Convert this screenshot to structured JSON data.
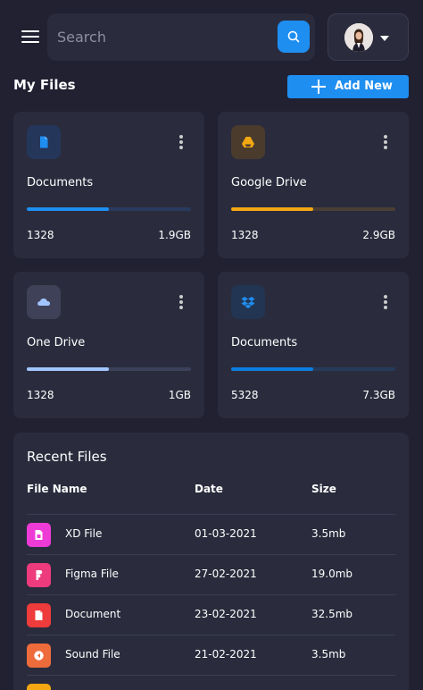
{
  "header": {
    "menu_icon": "hamburger-menu-icon",
    "search": {
      "placeholder": "Search",
      "value": "",
      "button_icon": "search-icon"
    },
    "profile": {
      "caret_icon": "caret-down-icon"
    }
  },
  "main": {
    "title": "My Files",
    "add_button": {
      "label": "Add New",
      "icon": "plus-icon"
    }
  },
  "storage_cards": [
    {
      "name": "Documents",
      "count": "1328",
      "size": "1.9GB",
      "usage": 0.5,
      "icon": "document-icon",
      "accent": "#1f8ef1"
    },
    {
      "name": "Google Drive",
      "count": "1328",
      "size": "2.9GB",
      "usage": 0.5,
      "icon": "google-drive-icon",
      "accent": "#f3a712"
    },
    {
      "name": "One Drive",
      "count": "1328",
      "size": "1GB",
      "usage": 0.5,
      "icon": "cloud-icon",
      "accent": "#a2c5ff"
    },
    {
      "name": "Documents",
      "count": "5328",
      "size": "7.3GB",
      "usage": 0.5,
      "icon": "dropbox-icon",
      "accent": "#0d7de0"
    }
  ],
  "recent_files": {
    "title": "Recent Files",
    "columns": [
      "File Name",
      "Date",
      "Size"
    ],
    "rows": [
      {
        "name": "XD File",
        "date": "01-03-2021",
        "size": "3.5mb",
        "icon": "xd-file-icon",
        "color": "#ee3bd6"
      },
      {
        "name": "Figma File",
        "date": "27-02-2021",
        "size": "19.0mb",
        "icon": "figma-icon",
        "color": "#ee3b7d"
      },
      {
        "name": "Document",
        "date": "23-02-2021",
        "size": "32.5mb",
        "icon": "document-icon",
        "color": "#ee3b3b"
      },
      {
        "name": "Sound File",
        "date": "21-02-2021",
        "size": "3.5mb",
        "icon": "sound-file-icon",
        "color": "#ee6b3b"
      }
    ]
  },
  "colors": {
    "background": "#212132",
    "surface": "#2a2c3d",
    "primary": "#1f8ef1"
  }
}
